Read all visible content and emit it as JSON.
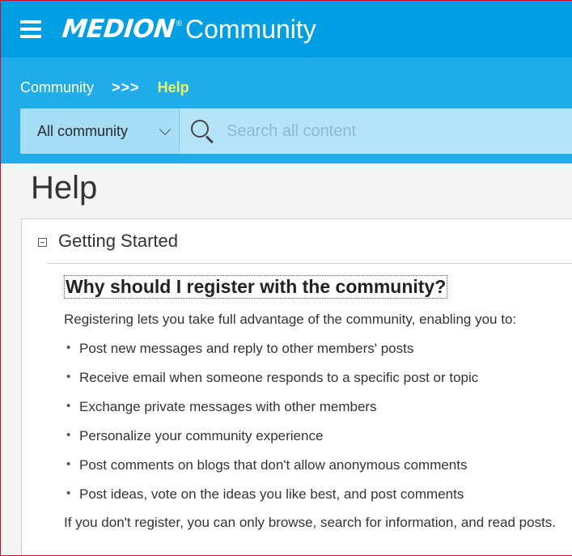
{
  "header": {
    "logo_text": "MEDION",
    "registered_mark": "®",
    "community_label": "Community"
  },
  "breadcrumb": {
    "root": "Community",
    "separator": ">>>",
    "current": "Help"
  },
  "search": {
    "scope": "All community",
    "placeholder": "Search all content"
  },
  "page": {
    "title": "Help"
  },
  "section": {
    "title": "Getting Started",
    "question": "Why should I register with the community?",
    "intro": "Registering lets you take full advantage of the community, enabling you to:",
    "bullets": [
      "Post new messages and reply to other members' posts",
      "Receive email when someone responds to a specific post or topic",
      "Exchange private messages with other members",
      "Personalize your community experience",
      "Post comments on blogs that don't allow anonymous comments",
      "Post ideas, vote on the ideas you like best, and post comments"
    ],
    "outro": "If you don't register, you can only browse, search for information, and read posts."
  },
  "colors": {
    "header_blue": "#009fe3",
    "band_blue": "#20ade9",
    "breadcrumb_current": "#e6f56a"
  }
}
